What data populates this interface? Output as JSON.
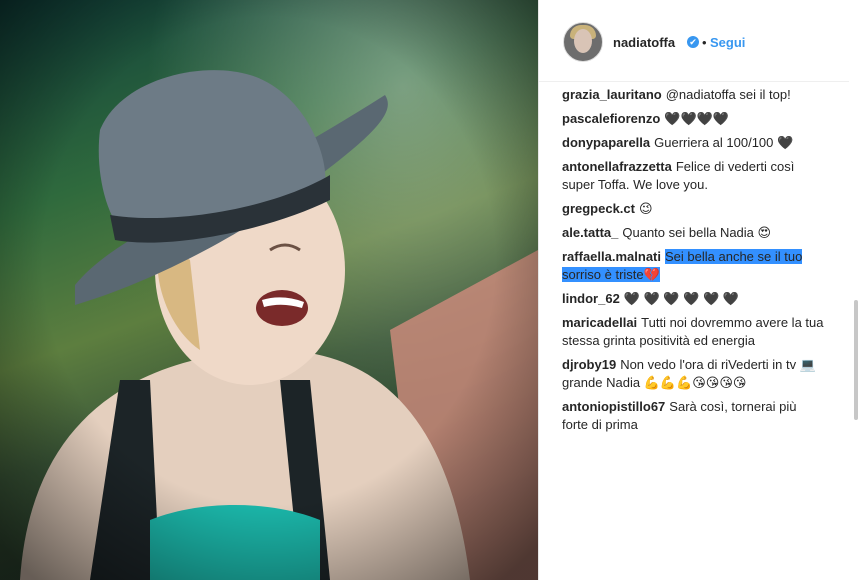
{
  "post": {
    "username": "nadiatoffa",
    "verified_badge": "✔",
    "separator": "•",
    "follow_label": "Segui"
  },
  "comments": [
    {
      "user": "grazia_lauritano",
      "text": "@nadiatoffa sei il top!"
    },
    {
      "user": "pascalefiorenzo",
      "text": "🖤🖤🖤🖤"
    },
    {
      "user": "donypaparella",
      "text": "Guerriera al 100/100 🖤"
    },
    {
      "user": "antonellafrazzetta",
      "text": "Felice di vederti così super Toffa. We love you."
    },
    {
      "user": "gregpeck.ct",
      "text": "😉"
    },
    {
      "user": "ale.tatta_",
      "text": "Quanto sei bella Nadia 😍"
    },
    {
      "user": "raffaella.malnati",
      "text": "Sei bella anche se il tuo sorriso è triste💔",
      "highlighted": true
    },
    {
      "user": "lindor_62",
      "text": "🖤 🖤 🖤 🖤 🖤 🖤"
    },
    {
      "user": "maricadellai",
      "text": "Tutti noi dovremmo avere la tua stessa grinta positività ed energia"
    },
    {
      "user": "djroby19",
      "text": "Non vedo l'ora di riVederti in tv 💻 grande Nadia 💪💪💪😘😘😘😘"
    },
    {
      "user": "antoniopistillo67",
      "text": "Sarà così, tornerai più forte di prima"
    }
  ]
}
